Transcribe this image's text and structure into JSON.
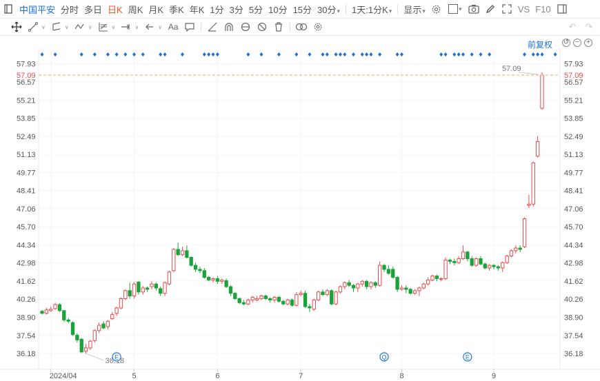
{
  "toolbar": {
    "stock_name": "中国平安",
    "periods": [
      "分时",
      "多日",
      "日K",
      "周K",
      "月K",
      "季K",
      "年K",
      "1分",
      "3分",
      "5分",
      "10分",
      "15分"
    ],
    "active_period": "日K",
    "period_30": "30分",
    "multi_period": "1天:1分K",
    "display": "显示",
    "vs": "VS",
    "f10": "F10"
  },
  "drawing_tools": [
    "crosshair-icon",
    "line-icon",
    "channel-icon",
    "wave-icon",
    "fib-icon",
    "measure-icon",
    "arrow-icon",
    "text-icon",
    "comment-icon",
    "ruler-icon",
    "magnet-icon",
    "hide-icon",
    "eye-off-icon",
    "trash-icon",
    "link-icon",
    "settings-icon"
  ],
  "drawing_text_tool": "Aa",
  "adjust_label": "前复权",
  "colors": {
    "up": "#e84a4a",
    "down": "#1aa33a",
    "accent": "#1e6fd9",
    "price_line": "#f2a65a"
  },
  "chart_data": {
    "type": "candlestick",
    "y_ticks": [
      57.93,
      57.09,
      56.57,
      55.21,
      53.85,
      52.49,
      51.13,
      49.77,
      48.41,
      47.06,
      45.7,
      44.34,
      42.98,
      41.62,
      40.26,
      38.9,
      37.54,
      36.18
    ],
    "ylim": [
      35.2,
      58.9
    ],
    "x_ticks": [
      {
        "label": "2024/04",
        "index": 2
      },
      {
        "label": "5",
        "index": 21
      },
      {
        "label": "6",
        "index": 40
      },
      {
        "label": "7",
        "index": 59
      },
      {
        "label": "8",
        "index": 82
      },
      {
        "label": "9",
        "index": 103
      }
    ],
    "current_price": 57.09,
    "current_price_label": "57.09",
    "min_label": "36.18",
    "min_index": 10,
    "min_price": 36.18,
    "event_markers": [
      {
        "index": 17,
        "text": "E"
      },
      {
        "index": 78,
        "text": "Q"
      },
      {
        "index": 97,
        "text": "E"
      }
    ],
    "dot_indices": [
      0,
      3,
      9,
      12,
      15,
      17,
      19,
      21,
      23,
      27,
      28,
      32,
      37,
      38,
      39,
      40,
      47,
      50,
      54,
      58,
      61,
      64,
      65,
      67,
      68,
      69,
      71,
      73,
      74,
      75,
      77,
      81,
      82,
      91,
      92,
      94,
      95,
      96,
      98,
      100,
      102,
      110,
      112,
      113,
      114,
      117
    ],
    "candles": [
      {
        "o": 39.35,
        "c": 39.2,
        "h": 39.45,
        "l": 39.1
      },
      {
        "o": 39.2,
        "c": 39.45,
        "h": 39.6,
        "l": 39.1
      },
      {
        "o": 39.4,
        "c": 39.5,
        "h": 39.7,
        "l": 39.3
      },
      {
        "o": 39.55,
        "c": 39.85,
        "h": 40.0,
        "l": 39.45
      },
      {
        "o": 39.85,
        "c": 39.4,
        "h": 39.95,
        "l": 39.3
      },
      {
        "o": 39.4,
        "c": 38.7,
        "h": 39.45,
        "l": 38.55
      },
      {
        "o": 38.7,
        "c": 38.6,
        "h": 38.85,
        "l": 38.45
      },
      {
        "o": 38.5,
        "c": 37.6,
        "h": 38.6,
        "l": 37.5
      },
      {
        "o": 37.55,
        "c": 37.2,
        "h": 37.7,
        "l": 37.0
      },
      {
        "o": 37.25,
        "c": 36.3,
        "h": 37.35,
        "l": 36.2
      },
      {
        "o": 36.35,
        "c": 36.6,
        "h": 36.9,
        "l": 36.18
      },
      {
        "o": 36.6,
        "c": 37.1,
        "h": 37.2,
        "l": 36.45
      },
      {
        "o": 37.15,
        "c": 37.9,
        "h": 38.0,
        "l": 37.0
      },
      {
        "o": 37.9,
        "c": 38.3,
        "h": 38.5,
        "l": 37.7
      },
      {
        "o": 38.4,
        "c": 38.1,
        "h": 38.6,
        "l": 38.0
      },
      {
        "o": 38.2,
        "c": 38.6,
        "h": 38.7,
        "l": 38.0
      },
      {
        "o": 38.8,
        "c": 39.1,
        "h": 39.3,
        "l": 38.7
      },
      {
        "o": 39.2,
        "c": 39.6,
        "h": 39.7,
        "l": 39.0
      },
      {
        "o": 39.6,
        "c": 40.3,
        "h": 40.4,
        "l": 39.5
      },
      {
        "o": 40.3,
        "c": 40.9,
        "h": 41.0,
        "l": 40.2
      },
      {
        "o": 40.9,
        "c": 40.5,
        "h": 41.5,
        "l": 40.3
      },
      {
        "o": 40.5,
        "c": 41.4,
        "h": 41.55,
        "l": 40.3
      },
      {
        "o": 41.55,
        "c": 40.8,
        "h": 41.6,
        "l": 40.6
      },
      {
        "o": 40.8,
        "c": 41.1,
        "h": 41.25,
        "l": 40.6
      },
      {
        "o": 41.1,
        "c": 41.0,
        "h": 41.2,
        "l": 40.8
      },
      {
        "o": 41.2,
        "c": 41.4,
        "h": 41.6,
        "l": 41.0
      },
      {
        "o": 41.4,
        "c": 41.1,
        "h": 41.5,
        "l": 40.9
      },
      {
        "o": 41.05,
        "c": 40.7,
        "h": 41.2,
        "l": 40.5
      },
      {
        "o": 40.7,
        "c": 41.5,
        "h": 41.6,
        "l": 40.5
      },
      {
        "o": 41.4,
        "c": 42.3,
        "h": 42.4,
        "l": 41.3
      },
      {
        "o": 42.4,
        "c": 44.0,
        "h": 44.1,
        "l": 42.3
      },
      {
        "o": 44.0,
        "c": 43.6,
        "h": 44.5,
        "l": 43.5
      },
      {
        "o": 43.6,
        "c": 43.9,
        "h": 44.2,
        "l": 43.5
      },
      {
        "o": 43.9,
        "c": 43.4,
        "h": 44.3,
        "l": 43.3
      },
      {
        "o": 43.4,
        "c": 42.8,
        "h": 43.5,
        "l": 42.7
      },
      {
        "o": 42.8,
        "c": 42.5,
        "h": 43.0,
        "l": 42.3
      },
      {
        "o": 42.5,
        "c": 42.4,
        "h": 42.7,
        "l": 42.2
      },
      {
        "o": 42.4,
        "c": 41.9,
        "h": 42.6,
        "l": 41.8
      },
      {
        "o": 41.9,
        "c": 41.7,
        "h": 42.0,
        "l": 41.6
      },
      {
        "o": 41.7,
        "c": 41.8,
        "h": 41.9,
        "l": 41.5
      },
      {
        "o": 41.8,
        "c": 41.6,
        "h": 42.0,
        "l": 41.4
      },
      {
        "o": 41.6,
        "c": 41.7,
        "h": 41.8,
        "l": 41.4
      },
      {
        "o": 41.65,
        "c": 41.2,
        "h": 41.8,
        "l": 41.1
      },
      {
        "o": 41.2,
        "c": 40.7,
        "h": 41.3,
        "l": 40.5
      },
      {
        "o": 40.7,
        "c": 40.3,
        "h": 40.8,
        "l": 40.2
      },
      {
        "o": 40.3,
        "c": 40.0,
        "h": 40.4,
        "l": 39.9
      },
      {
        "o": 40.0,
        "c": 39.9,
        "h": 40.2,
        "l": 39.8
      },
      {
        "o": 39.9,
        "c": 40.2,
        "h": 40.3,
        "l": 39.8
      },
      {
        "o": 40.2,
        "c": 40.4,
        "h": 40.5,
        "l": 40.0
      },
      {
        "o": 40.2,
        "c": 40.3,
        "h": 40.5,
        "l": 40.1
      },
      {
        "o": 40.3,
        "c": 40.5,
        "h": 40.6,
        "l": 40.2
      },
      {
        "o": 40.5,
        "c": 40.3,
        "h": 40.6,
        "l": 40.2
      },
      {
        "o": 40.3,
        "c": 40.2,
        "h": 40.4,
        "l": 40.0
      },
      {
        "o": 40.2,
        "c": 40.4,
        "h": 40.5,
        "l": 40.0
      },
      {
        "o": 40.4,
        "c": 40.1,
        "h": 40.5,
        "l": 40.0
      },
      {
        "o": 40.1,
        "c": 39.9,
        "h": 40.2,
        "l": 39.8
      },
      {
        "o": 39.9,
        "c": 40.2,
        "h": 40.3,
        "l": 39.8
      },
      {
        "o": 40.2,
        "c": 39.8,
        "h": 40.3,
        "l": 39.7
      },
      {
        "o": 39.8,
        "c": 40.6,
        "h": 40.8,
        "l": 39.7
      },
      {
        "o": 40.6,
        "c": 40.7,
        "h": 40.9,
        "l": 40.5
      },
      {
        "o": 40.7,
        "c": 39.7,
        "h": 40.9,
        "l": 39.6
      },
      {
        "o": 39.7,
        "c": 39.6,
        "h": 39.9,
        "l": 39.3
      },
      {
        "o": 39.5,
        "c": 40.2,
        "h": 40.3,
        "l": 39.4
      },
      {
        "o": 40.2,
        "c": 40.8,
        "h": 40.9,
        "l": 40.1
      },
      {
        "o": 40.8,
        "c": 40.6,
        "h": 41.0,
        "l": 40.5
      },
      {
        "o": 40.6,
        "c": 40.9,
        "h": 41.0,
        "l": 40.5
      },
      {
        "o": 40.9,
        "c": 39.9,
        "h": 41.0,
        "l": 39.8
      },
      {
        "o": 39.9,
        "c": 40.8,
        "h": 40.9,
        "l": 39.8
      },
      {
        "o": 40.8,
        "c": 41.2,
        "h": 41.3,
        "l": 40.7
      },
      {
        "o": 41.2,
        "c": 41.5,
        "h": 41.6,
        "l": 41.0
      },
      {
        "o": 41.5,
        "c": 41.3,
        "h": 41.7,
        "l": 41.2
      },
      {
        "o": 41.3,
        "c": 41.1,
        "h": 41.4,
        "l": 40.8
      },
      {
        "o": 41.1,
        "c": 41.4,
        "h": 41.5,
        "l": 40.8
      },
      {
        "o": 41.4,
        "c": 41.6,
        "h": 41.7,
        "l": 41.2
      },
      {
        "o": 41.6,
        "c": 41.2,
        "h": 41.7,
        "l": 41.0
      },
      {
        "o": 41.2,
        "c": 41.5,
        "h": 41.6,
        "l": 41.0
      },
      {
        "o": 41.5,
        "c": 41.3,
        "h": 41.6,
        "l": 41.1
      },
      {
        "o": 41.3,
        "c": 42.8,
        "h": 43.1,
        "l": 41.2
      },
      {
        "o": 42.8,
        "c": 42.5,
        "h": 42.9,
        "l": 42.3
      },
      {
        "o": 42.5,
        "c": 42.2,
        "h": 42.8,
        "l": 42.1
      },
      {
        "o": 42.5,
        "c": 41.9,
        "h": 42.7,
        "l": 41.8
      },
      {
        "o": 41.9,
        "c": 41.0,
        "h": 42.0,
        "l": 40.8
      },
      {
        "o": 41.0,
        "c": 41.1,
        "h": 41.3,
        "l": 40.9
      },
      {
        "o": 41.1,
        "c": 41.0,
        "h": 41.3,
        "l": 40.7
      },
      {
        "o": 41.0,
        "c": 40.7,
        "h": 41.1,
        "l": 40.6
      },
      {
        "o": 40.7,
        "c": 40.9,
        "h": 41.0,
        "l": 40.6
      },
      {
        "o": 40.9,
        "c": 41.1,
        "h": 41.2,
        "l": 40.5
      },
      {
        "o": 41.1,
        "c": 41.4,
        "h": 41.5,
        "l": 41.0
      },
      {
        "o": 41.4,
        "c": 41.7,
        "h": 41.9,
        "l": 41.3
      },
      {
        "o": 41.7,
        "c": 42.0,
        "h": 42.1,
        "l": 41.6
      },
      {
        "o": 42.0,
        "c": 41.8,
        "h": 42.1,
        "l": 41.6
      },
      {
        "o": 41.8,
        "c": 41.8,
        "h": 41.9,
        "l": 41.6
      },
      {
        "o": 41.8,
        "c": 43.2,
        "h": 43.4,
        "l": 41.7
      },
      {
        "o": 43.2,
        "c": 43.1,
        "h": 43.3,
        "l": 42.9
      },
      {
        "o": 43.1,
        "c": 43.0,
        "h": 43.3,
        "l": 42.8
      },
      {
        "o": 43.0,
        "c": 43.3,
        "h": 43.5,
        "l": 42.9
      },
      {
        "o": 43.3,
        "c": 43.8,
        "h": 44.3,
        "l": 43.2
      },
      {
        "o": 43.8,
        "c": 43.3,
        "h": 43.9,
        "l": 43.1
      },
      {
        "o": 43.3,
        "c": 42.8,
        "h": 43.5,
        "l": 42.7
      },
      {
        "o": 42.8,
        "c": 43.3,
        "h": 43.4,
        "l": 42.7
      },
      {
        "o": 43.3,
        "c": 42.9,
        "h": 43.5,
        "l": 42.8
      },
      {
        "o": 42.9,
        "c": 42.6,
        "h": 43.0,
        "l": 42.5
      },
      {
        "o": 42.6,
        "c": 42.8,
        "h": 42.9,
        "l": 42.4
      },
      {
        "o": 42.8,
        "c": 42.7,
        "h": 42.9,
        "l": 42.5
      },
      {
        "o": 42.7,
        "c": 42.6,
        "h": 42.8,
        "l": 42.4
      },
      {
        "o": 42.6,
        "c": 43.0,
        "h": 43.1,
        "l": 42.3
      },
      {
        "o": 43.0,
        "c": 43.5,
        "h": 43.6,
        "l": 42.9
      },
      {
        "o": 43.5,
        "c": 43.9,
        "h": 44.0,
        "l": 43.4
      },
      {
        "o": 43.9,
        "c": 44.1,
        "h": 44.3,
        "l": 43.7
      },
      {
        "o": 44.1,
        "c": 44.0,
        "h": 44.3,
        "l": 43.8
      },
      {
        "o": 44.2,
        "c": 46.3,
        "h": 46.4,
        "l": 44.1
      },
      {
        "o": 47.3,
        "c": 47.4,
        "h": 48.1,
        "l": 47.1
      },
      {
        "o": 47.4,
        "c": 50.5,
        "h": 50.6,
        "l": 47.2
      },
      {
        "o": 51.0,
        "c": 52.1,
        "h": 52.5,
        "l": 50.9
      },
      {
        "o": 54.6,
        "c": 57.09,
        "h": 57.3,
        "l": 54.5
      }
    ]
  }
}
